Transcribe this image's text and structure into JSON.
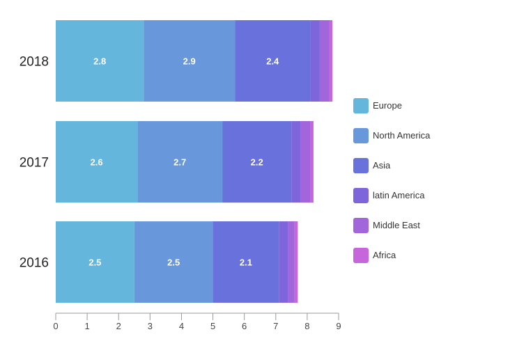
{
  "chart_data": {
    "type": "bar",
    "orientation": "horizontal",
    "stacked": true,
    "title": "",
    "xlabel": "",
    "ylabel": "",
    "categories": [
      "2018",
      "2017",
      "2016"
    ],
    "xlim": [
      0,
      9
    ],
    "x_ticks": [
      "0",
      "1",
      "2",
      "3",
      "4",
      "5",
      "6",
      "7",
      "8",
      "9"
    ],
    "grid": false,
    "legend_position": "right",
    "series": [
      {
        "name": "Europe",
        "color": "#65b6dc",
        "values": [
          2.8,
          2.6,
          2.5
        ],
        "labels": [
          "2.8",
          "2.6",
          "2.5"
        ]
      },
      {
        "name": "North America",
        "color": "#6897dc",
        "values": [
          2.9,
          2.7,
          2.5
        ],
        "labels": [
          "2.9",
          "2.7",
          "2.5"
        ]
      },
      {
        "name": "Asia",
        "color": "#6972dc",
        "values": [
          2.4,
          2.2,
          2.1
        ],
        "labels": [
          "2.4",
          "2.2",
          "2.1"
        ]
      },
      {
        "name": "latin America",
        "color": "#7e65dc",
        "values": [
          0.3,
          0.3,
          0.3
        ],
        "labels": [
          "",
          "",
          ""
        ]
      },
      {
        "name": "Middle East",
        "color": "#a365dc",
        "values": [
          0.3,
          0.3,
          0.2
        ],
        "labels": [
          "",
          "",
          ""
        ]
      },
      {
        "name": "Africa",
        "color": "#c765dc",
        "values": [
          0.1,
          0.1,
          0.1
        ],
        "labels": [
          "",
          "",
          ""
        ]
      }
    ]
  }
}
